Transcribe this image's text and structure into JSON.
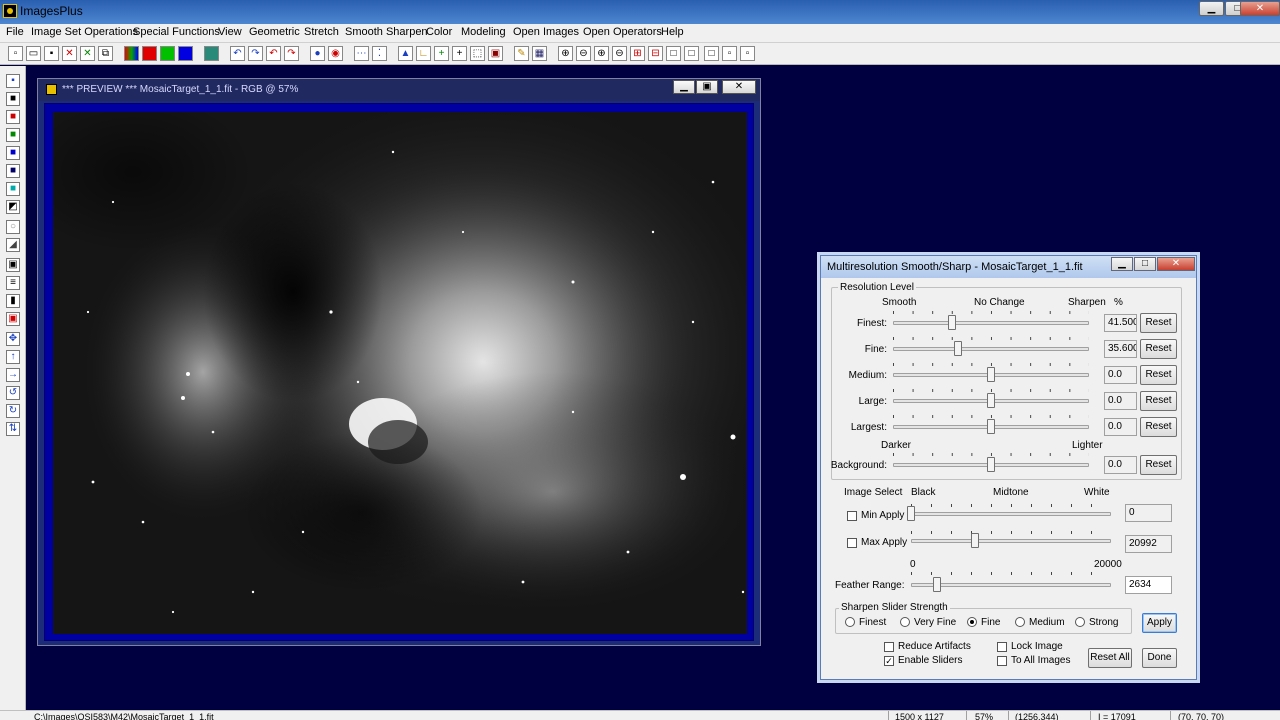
{
  "app": {
    "title": "ImagesPlus"
  },
  "menu": [
    "File",
    "Image Set Operations",
    "Special Functions",
    "View",
    "Geometric",
    "Stretch",
    "Smooth Sharpen",
    "Color",
    "Modeling",
    "Open Images",
    "Open Operators",
    "Help"
  ],
  "toolbar_icons": [
    "new-icon",
    "open-icon",
    "save-icon",
    "close-x-icon",
    "close-x-green-icon",
    "copy-icon",
    "rgb-icon",
    "red-channel-icon",
    "green-channel-icon",
    "blue-channel-icon",
    "grid-icon",
    "undo-icon",
    "redo-icon",
    "undo-all-icon",
    "redo-all-icon",
    "zoom-fit-icon",
    "target-icon",
    "line-icon",
    "point-icon",
    "peak-icon",
    "corner-icon",
    "add-icon",
    "crosshair-icon",
    "select-icon",
    "paint-icon",
    "pencil-icon",
    "mosaic-icon",
    "zoom-in-icon",
    "zoom-out-icon",
    "zoom-in-alt-icon",
    "zoom-out-alt-icon",
    "zoom-red-plus-icon",
    "zoom-red-minus-icon",
    "frame-icon",
    "frame-alt-icon",
    "square-icon",
    "square-small-icon",
    "square-tiny-icon"
  ],
  "preview": {
    "title": "*** PREVIEW *** MosaicTarget_1_1.fit - RGB @ 57%"
  },
  "dialog": {
    "title": "Multiresolution Smooth/Sharp - MosaicTarget_1_1.fit",
    "resolution_group": "Resolution Level",
    "header_smooth": "Smooth",
    "header_nochange": "No Change",
    "header_sharpen": "Sharpen",
    "header_pct": "%",
    "darker": "Darker",
    "lighter": "Lighter",
    "reset_label": "Reset",
    "levels": [
      {
        "label": "Finest:",
        "value": "41.5000",
        "pos": 0.3
      },
      {
        "label": "Fine:",
        "value": "35.6000",
        "pos": 0.33
      },
      {
        "label": "Medium:",
        "value": "0.0",
        "pos": 0.5
      },
      {
        "label": "Large:",
        "value": "0.0",
        "pos": 0.5
      },
      {
        "label": "Largest:",
        "value": "0.0",
        "pos": 0.5
      },
      {
        "label": "Background:",
        "value": "0.0",
        "pos": 0.5
      }
    ],
    "image_select": "Image Select",
    "black": "Black",
    "midtone": "Midtone",
    "white": "White",
    "min_apply": "Min Apply",
    "min_value": "0",
    "min_pos": 0.0,
    "max_apply": "Max Apply",
    "max_value": "20992",
    "max_pos": 0.32,
    "range_min": "0",
    "range_max": "20000",
    "feather_label": "Feather Range:",
    "feather_value": "2634",
    "feather_pos": 0.13,
    "strength_group": "Sharpen Slider Strength",
    "strengths": [
      {
        "label": "Finest",
        "checked": false
      },
      {
        "label": "Very Fine",
        "checked": false
      },
      {
        "label": "Fine",
        "checked": true
      },
      {
        "label": "Medium",
        "checked": false
      },
      {
        "label": "Strong",
        "checked": false
      }
    ],
    "apply": "Apply",
    "reduce_artifacts": "Reduce Artifacts",
    "enable_sliders": "Enable Sliders",
    "lock_image": "Lock Image",
    "to_all_images": "To All Images",
    "reset_all": "Reset All",
    "done": "Done"
  },
  "status": {
    "path": "C:\\Images\\QSI583\\M42\\MosaicTarget_1_1.fit",
    "size": "1500 x 1127",
    "zoom": "57%",
    "coords": "(1256,344)",
    "intensity": "I = 17091",
    "rgb": "(70, 70, 70)"
  }
}
